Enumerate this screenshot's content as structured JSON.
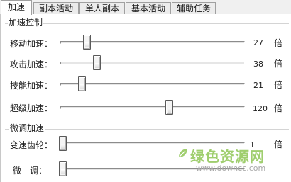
{
  "tabs": [
    {
      "label": "加速",
      "active": true
    },
    {
      "label": "副本活动",
      "active": false
    },
    {
      "label": "单人副本",
      "active": false
    },
    {
      "label": "基本活动",
      "active": false
    },
    {
      "label": "辅助任务",
      "active": false
    }
  ],
  "speed_group": {
    "title": "加速控制",
    "rows": [
      {
        "label": "移动加速：",
        "value": "27",
        "unit": "倍"
      },
      {
        "label": "攻击加速：",
        "value": "38",
        "unit": "倍"
      },
      {
        "label": "技能加速：",
        "value": "21",
        "unit": "倍"
      },
      {
        "label": "超级加速：",
        "value": "120",
        "unit": "倍"
      }
    ]
  },
  "fine_group": {
    "title": "微调加速",
    "rows": [
      {
        "label": "变速齿轮：",
        "value": "1",
        "unit": "倍"
      },
      {
        "label": "微　调：",
        "value": "",
        "unit": ""
      }
    ]
  },
  "watermark": {
    "name": "绿色资源网",
    "url": "www.downcc.com",
    "color": "#9fce6e"
  }
}
